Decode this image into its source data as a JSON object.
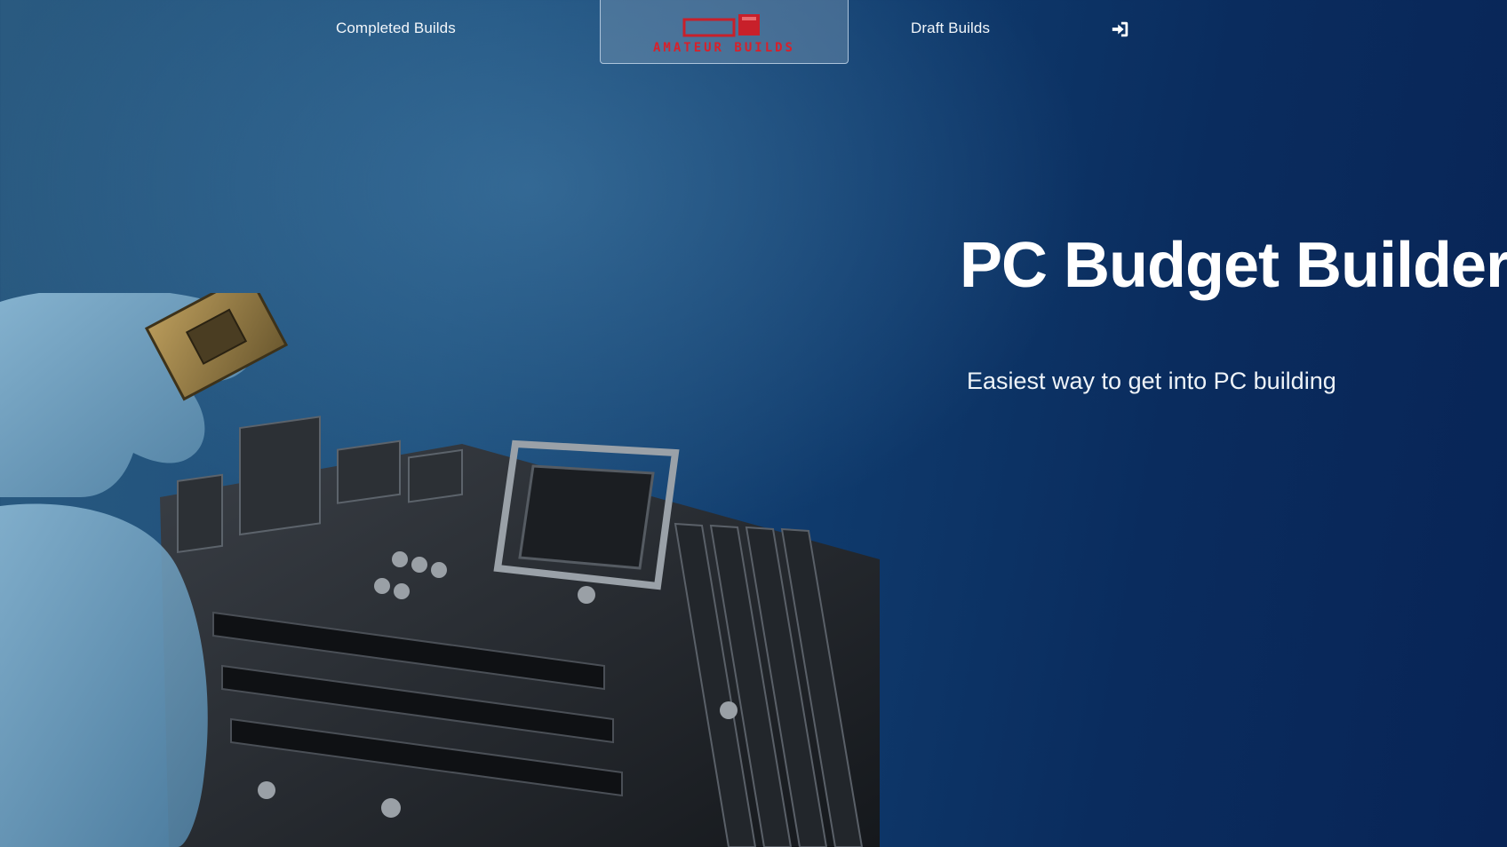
{
  "nav": {
    "completed_label": "Completed Builds",
    "draft_label": "Draft Builds",
    "login_icon": "sign-in-icon",
    "logo_text": "AMATEUR BUILDS"
  },
  "hero": {
    "title": "PC Budget Builder",
    "subtitle": "Easiest way to get into PC building"
  },
  "colors": {
    "background_dark": "#082456",
    "background_light": "#2a5a80",
    "logo_red": "#d8202a",
    "text": "#ffffff"
  }
}
